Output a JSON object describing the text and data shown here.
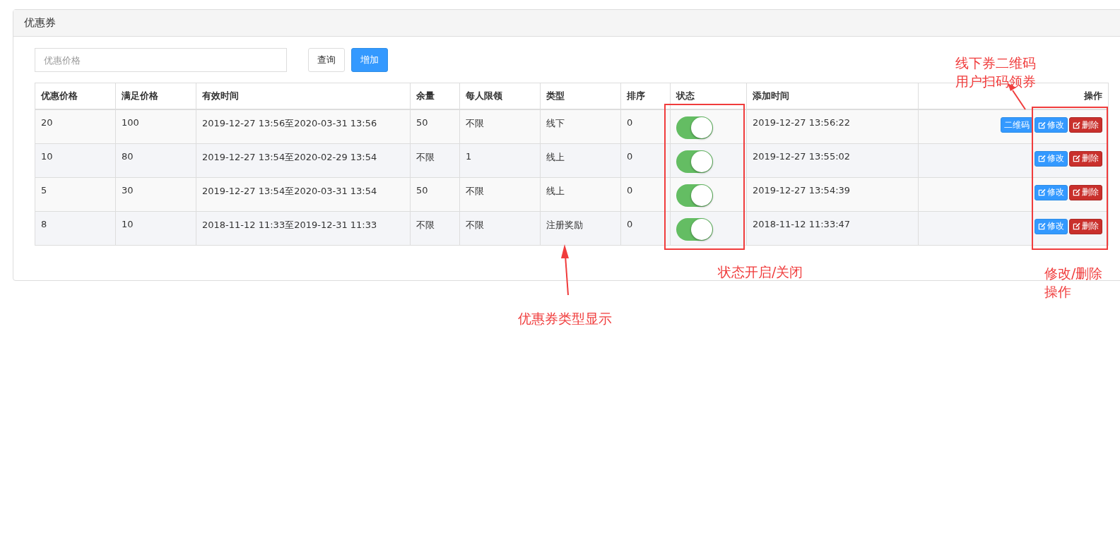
{
  "panel": {
    "title": "优惠券"
  },
  "toolbar": {
    "search": {
      "placeholder": "优惠价格"
    },
    "buttons": [
      {
        "label": "查询",
        "kind": "default"
      },
      {
        "label": "增加",
        "kind": "primary"
      }
    ]
  },
  "table": {
    "columns": [
      "优惠价格",
      "满足价格",
      "有效时间",
      "余量",
      "每人限领",
      "类型",
      "排序",
      "状态",
      "添加时间",
      "操作"
    ],
    "rows": [
      {
        "discount": "20",
        "threshold": "100",
        "period": "2019-12-27 13:56至2020-03-31 13:56",
        "stock": "50",
        "limit": "不限",
        "type": "线下",
        "sort": "0",
        "on": true,
        "added": "2019-12-27 13:56:22",
        "actions": [
          {
            "label": "二维码",
            "kind": "qrcode"
          },
          {
            "label": "修改",
            "kind": "edit"
          },
          {
            "label": "删除",
            "kind": "delete"
          }
        ]
      },
      {
        "discount": "10",
        "threshold": "80",
        "period": "2019-12-27 13:54至2020-02-29 13:54",
        "stock": "不限",
        "limit": "1",
        "type": "线上",
        "sort": "0",
        "on": true,
        "added": "2019-12-27 13:55:02",
        "actions": [
          {
            "label": "修改",
            "kind": "edit"
          },
          {
            "label": "删除",
            "kind": "delete"
          }
        ]
      },
      {
        "discount": "5",
        "threshold": "30",
        "period": "2019-12-27 13:54至2020-03-31 13:54",
        "stock": "50",
        "limit": "不限",
        "type": "线上",
        "sort": "0",
        "on": true,
        "added": "2019-12-27 13:54:39",
        "actions": [
          {
            "label": "修改",
            "kind": "edit"
          },
          {
            "label": "删除",
            "kind": "delete"
          }
        ]
      },
      {
        "discount": "8",
        "threshold": "10",
        "period": "2018-11-12 11:33至2019-12-31 11:33",
        "stock": "不限",
        "limit": "不限",
        "type": "注册奖励",
        "sort": "0",
        "on": true,
        "added": "2018-11-12 11:33:47",
        "actions": [
          {
            "label": "修改",
            "kind": "edit"
          },
          {
            "label": "删除",
            "kind": "delete"
          }
        ]
      }
    ]
  },
  "annotations": [
    {
      "kind": "qrcode",
      "lines": [
        "线下券二维码",
        "用户扫码领券"
      ]
    },
    {
      "kind": "status",
      "lines": [
        "状态开启/关闭"
      ]
    },
    {
      "kind": "actions",
      "lines": [
        "修改/删除",
        "操作"
      ]
    },
    {
      "kind": "type",
      "lines": [
        "优惠券类型显示"
      ]
    }
  ]
}
